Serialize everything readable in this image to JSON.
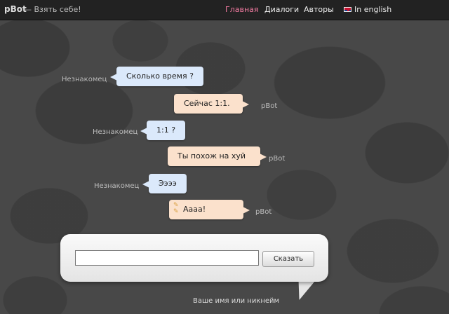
{
  "header": {
    "logo": "pBot",
    "tagline": "— Взять себе!",
    "nav": [
      {
        "label": "Главная",
        "active": true
      },
      {
        "label": "Диалоги",
        "active": false
      },
      {
        "label": "Авторы",
        "active": false
      },
      {
        "label": "In english",
        "active": false,
        "icon": "uk-flag-icon"
      }
    ]
  },
  "chat": [
    {
      "speaker": "Незнакомец",
      "text": "Сколько время ?",
      "role": "stranger"
    },
    {
      "speaker": "pBot",
      "text": "Сейчас 1:1.",
      "role": "bot"
    },
    {
      "speaker": "Незнакомец",
      "text": "1:1 ?",
      "role": "stranger"
    },
    {
      "speaker": "pBot",
      "text": "Ты похож на хуй",
      "role": "bot"
    },
    {
      "speaker": "Незнакомец",
      "text": "Ээээ",
      "role": "stranger"
    },
    {
      "speaker": "pBot",
      "text": "Аааа!",
      "role": "bot",
      "icon": "pencil-icon"
    }
  ],
  "input": {
    "value": "",
    "button_label": "Сказать",
    "nickname_label": "Ваше имя или никнейм"
  },
  "colors": {
    "stranger_bubble": "#dbe9fb",
    "bot_bubble": "#fbe1cc",
    "active_nav": "#f07aa0"
  }
}
